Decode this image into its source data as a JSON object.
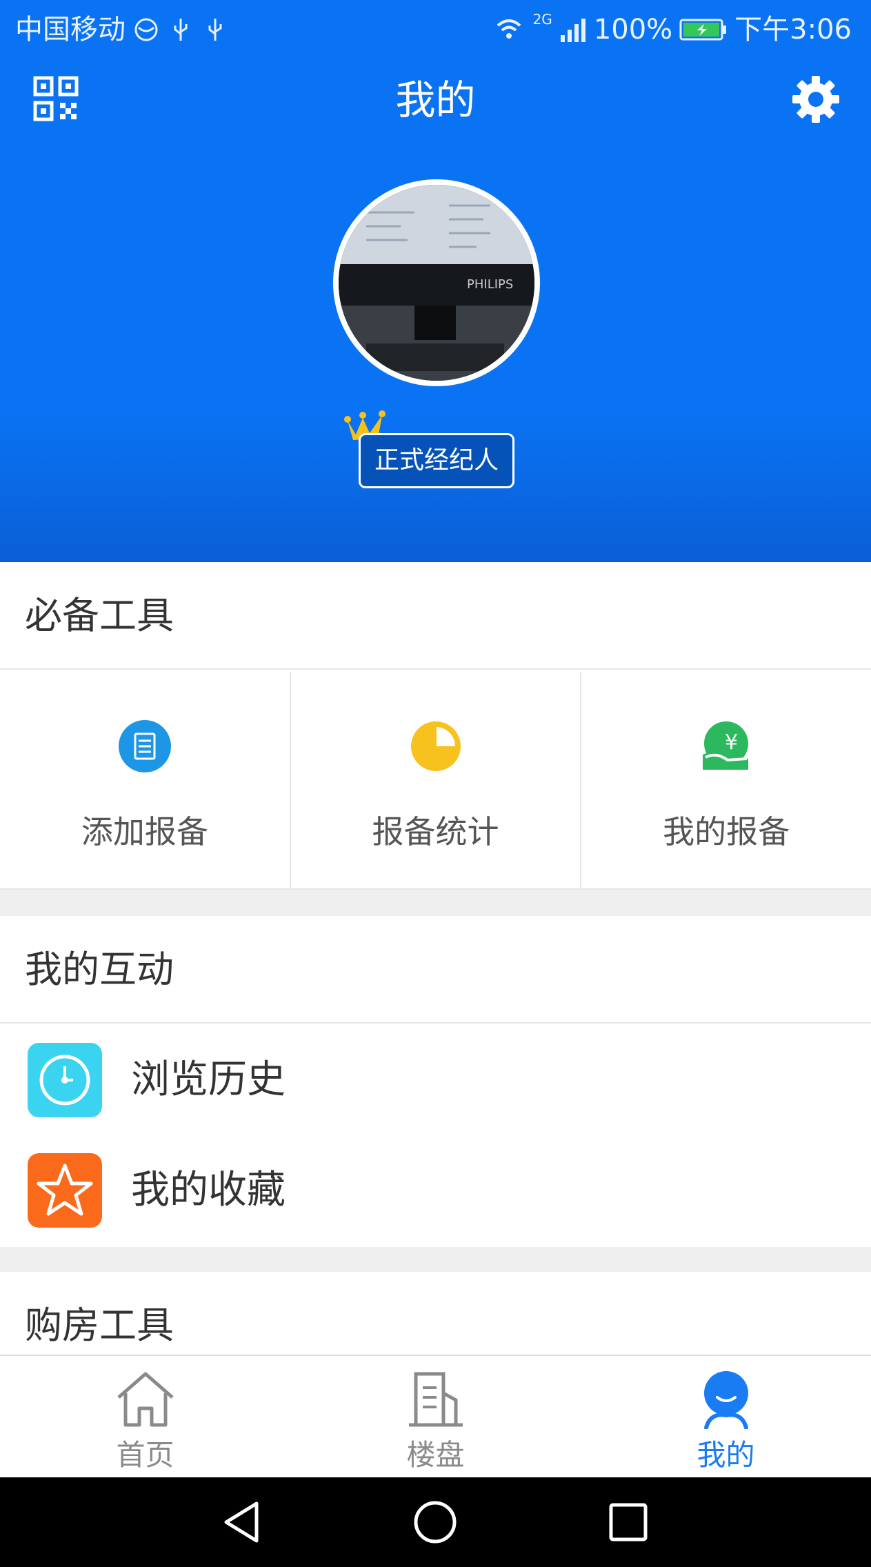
{
  "status_bar": {
    "carrier": "中国移动",
    "network": "2G",
    "battery": "100%",
    "time": "下午3:06"
  },
  "header": {
    "title": "我的",
    "qr_icon": "qr-code-icon",
    "settings_icon": "gear-icon",
    "badge": "正式经纪人",
    "avatar_brand_text": "PHILIPS"
  },
  "sections": {
    "essential_tools": {
      "title": "必备工具",
      "items": [
        {
          "label": "添加报备",
          "icon": "document-icon",
          "color": "#1e96e6"
        },
        {
          "label": "报备统计",
          "icon": "pie-chart-icon",
          "color": "#f7c21e"
        },
        {
          "label": "我的报备",
          "icon": "money-hand-icon",
          "color": "#2cb85f"
        }
      ]
    },
    "interactions": {
      "title": "我的互动",
      "items": [
        {
          "label": "浏览历史",
          "icon": "clock-icon",
          "color": "#3ad4f0"
        },
        {
          "label": "我的收藏",
          "icon": "star-icon",
          "color": "#fb6a1a"
        }
      ]
    },
    "purchase_tools": {
      "title": "购房工具"
    }
  },
  "tab_bar": {
    "items": [
      {
        "label": "首页",
        "icon": "home-icon"
      },
      {
        "label": "楼盘",
        "icon": "building-icon"
      },
      {
        "label": "我的",
        "icon": "profile-icon",
        "active": true
      }
    ],
    "active_color": "#1a7cf2"
  },
  "colors": {
    "primary": "#0a73f3",
    "badge_bg": "#0553b8"
  }
}
